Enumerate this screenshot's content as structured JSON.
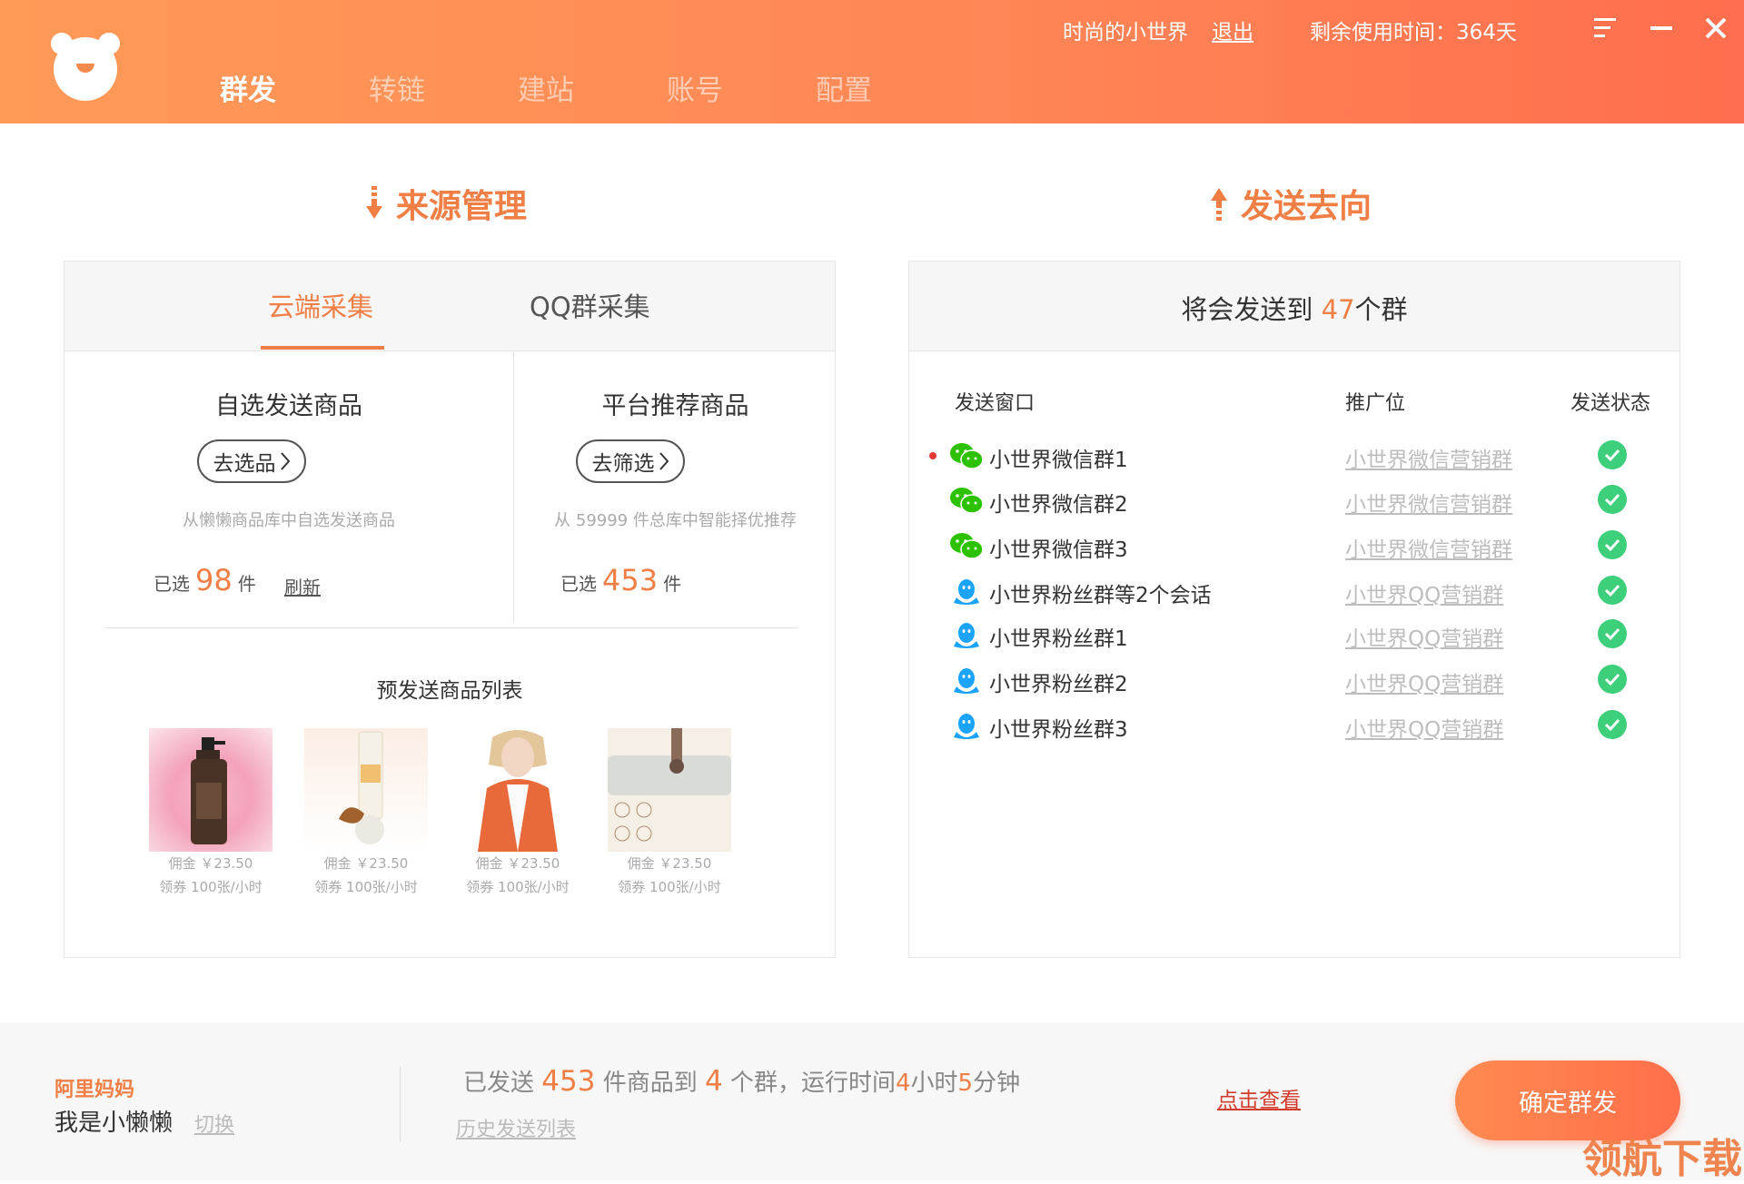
{
  "header": {
    "nav": [
      "群发",
      "转链",
      "建站",
      "账号",
      "配置"
    ],
    "username": "时尚的小世界",
    "logout": "退出",
    "remaining": "剩余使用时间：364天"
  },
  "source": {
    "title": "来源管理",
    "tabs": [
      "云端采集",
      "QQ群采集"
    ],
    "self_select": {
      "title": "自选发送商品",
      "button": "去选品",
      "hint": "从懒懒商品库中自选发送商品",
      "selected_prefix": "已选",
      "count": "98",
      "unit": "件",
      "refresh": "刷新"
    },
    "platform": {
      "title": "平台推荐商品",
      "button": "去筛选",
      "hint": "从 59999 件总库中智能择优推荐",
      "selected_prefix": "已选",
      "count": "453",
      "unit": "件"
    },
    "product_list_title": "预发送商品列表",
    "products": [
      {
        "commission": "佣金 ￥23.50",
        "coupon": "领券 100张/小时"
      },
      {
        "commission": "佣金 ￥23.50",
        "coupon": "领券 100张/小时"
      },
      {
        "commission": "佣金 ￥23.50",
        "coupon": "领券 100张/小时"
      },
      {
        "commission": "佣金 ￥23.50",
        "coupon": "领券 100张/小时"
      }
    ]
  },
  "target": {
    "title": "发送去向",
    "summary_prefix": "将会发送到 ",
    "summary_count": "47",
    "summary_suffix": "个群",
    "columns": [
      "发送窗口",
      "推广位",
      "发送状态"
    ],
    "rows": [
      {
        "name": "小世界微信群1",
        "promo": "小世界微信营销群",
        "type": "wechat"
      },
      {
        "name": "小世界微信群2",
        "promo": "小世界微信营销群",
        "type": "wechat"
      },
      {
        "name": "小世界微信群3",
        "promo": "小世界微信营销群",
        "type": "wechat"
      },
      {
        "name": "小世界粉丝群等2个会话",
        "promo": "小世界QQ营销群",
        "type": "qq"
      },
      {
        "name": "小世界粉丝群1",
        "promo": "小世界QQ营销群",
        "type": "qq"
      },
      {
        "name": "小世界粉丝群2",
        "promo": "小世界QQ营销群",
        "type": "qq"
      },
      {
        "name": "小世界粉丝群3",
        "promo": "小世界QQ营销群",
        "type": "qq"
      }
    ]
  },
  "footer": {
    "brand": "阿里妈妈",
    "user": "我是小懒懒",
    "switch": "切换",
    "sent_prefix": "已发送 ",
    "sent_count": "453",
    "sent_mid": " 件商品到 ",
    "group_count": "4",
    "group_mid": " 个群，运行时间",
    "hours": "4",
    "hours_unit": "小时",
    "minutes": "5",
    "minutes_unit": "分钟",
    "history": "历史发送列表",
    "view": "点击查看",
    "confirm": "确定群发"
  },
  "watermark": "领航下载",
  "colors": {
    "accent": "#f07e45",
    "success": "#3ecf7a",
    "wechat": "#2dc100",
    "qq": "#1aa3ff"
  }
}
